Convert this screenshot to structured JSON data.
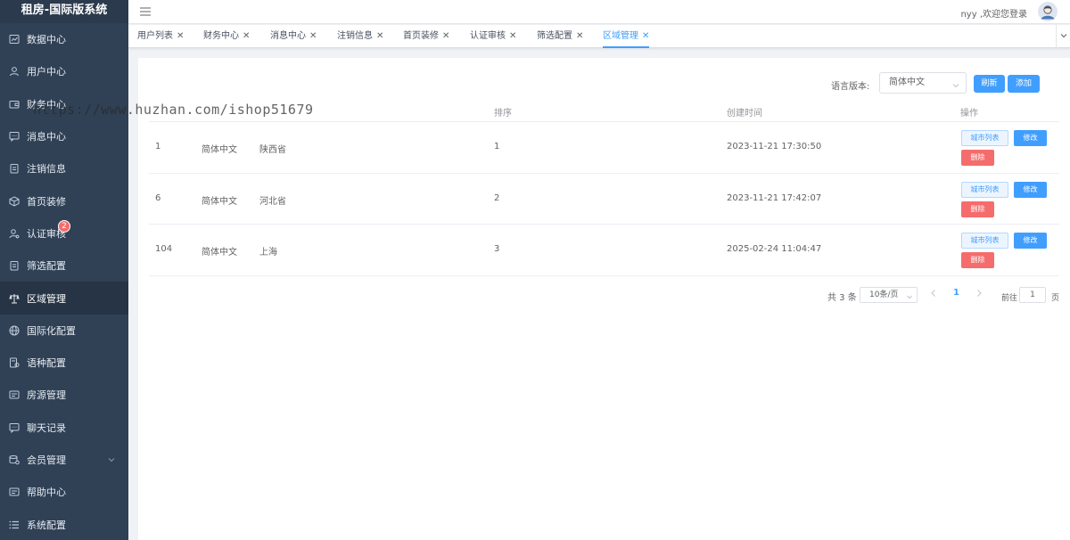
{
  "app": {
    "title": "租房-国际版系统"
  },
  "sidebar": {
    "items": [
      {
        "label": "数据中心",
        "icon": "dashboard-icon"
      },
      {
        "label": "用户中心",
        "icon": "user-icon"
      },
      {
        "label": "财务中心",
        "icon": "wallet-icon"
      },
      {
        "label": "消息中心",
        "icon": "message-icon"
      },
      {
        "label": "注销信息",
        "icon": "clipboard-icon"
      },
      {
        "label": "首页装修",
        "icon": "box-icon"
      },
      {
        "label": "认证审核",
        "icon": "user-check-icon",
        "badge": "2"
      },
      {
        "label": "筛选配置",
        "icon": "clipboard-icon"
      },
      {
        "label": "区域管理",
        "icon": "region-icon",
        "active": true
      },
      {
        "label": "国际化配置",
        "icon": "globe-icon"
      },
      {
        "label": "语种配置",
        "icon": "language-icon"
      },
      {
        "label": "房源管理",
        "icon": "house-icon"
      },
      {
        "label": "聊天记录",
        "icon": "chat-icon"
      },
      {
        "label": "会员管理",
        "icon": "member-icon"
      },
      {
        "label": "帮助中心",
        "icon": "help-icon"
      },
      {
        "label": "系统配置",
        "icon": "list-icon"
      }
    ]
  },
  "header": {
    "welcome": "nyy ,欢迎您登录"
  },
  "tabs": [
    {
      "label": "用户列表"
    },
    {
      "label": "财务中心"
    },
    {
      "label": "消息中心"
    },
    {
      "label": "注销信息"
    },
    {
      "label": "首页装修"
    },
    {
      "label": "认证审核"
    },
    {
      "label": "筛选配置"
    },
    {
      "label": "区域管理",
      "active": true
    }
  ],
  "toolbar": {
    "language_label": "语言版本:",
    "language_value": "简体中文",
    "refresh_label": "刷新",
    "add_label": "添加"
  },
  "table": {
    "headers": {
      "sort": "排序",
      "created": "创建时间",
      "ops": "操作"
    },
    "rows": [
      {
        "id": "1",
        "lang": "简体中文",
        "name": "陕西省",
        "sort": "1",
        "created": "2023-11-21 17:30:50"
      },
      {
        "id": "6",
        "lang": "简体中文",
        "name": "河北省",
        "sort": "2",
        "created": "2023-11-21 17:42:07"
      },
      {
        "id": "104",
        "lang": "简体中文",
        "name": "上海",
        "sort": "3",
        "created": "2025-02-24 11:04:47"
      }
    ],
    "actions": {
      "city_list": "城市列表",
      "edit": "修改",
      "delete": "删除"
    }
  },
  "pagination": {
    "total": "共 3 条",
    "page_size": "10条/页",
    "current": "1",
    "goto_label": "前往",
    "goto_value": "1",
    "page_suffix": "页"
  },
  "watermark": {
    "text": "https://www.huzhan.com/ishop51679"
  },
  "colors": {
    "primary": "#409eff",
    "danger": "#f56c6c",
    "sidebar_bg": "#304156"
  }
}
